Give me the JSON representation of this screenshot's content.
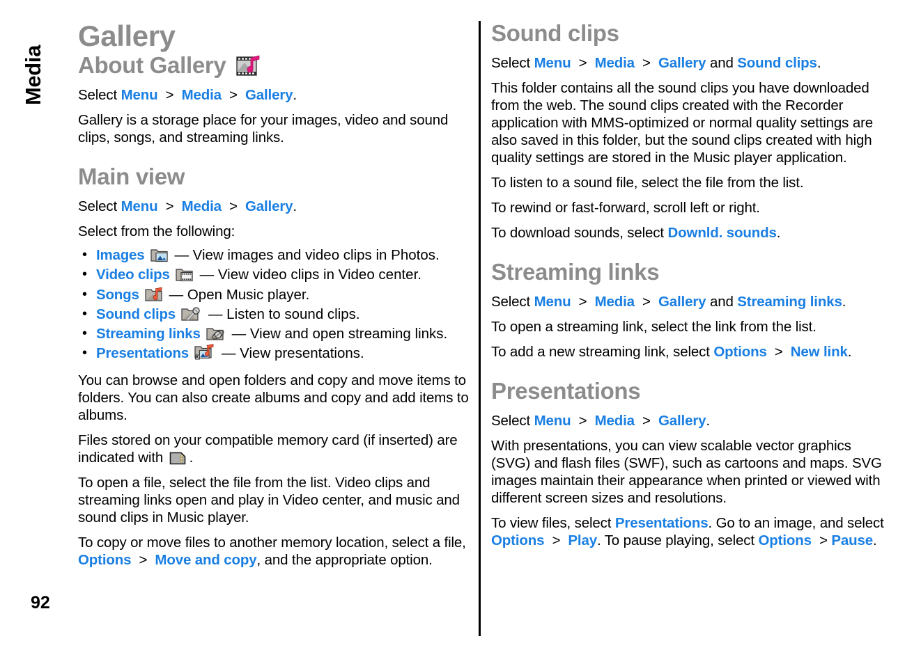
{
  "page": {
    "number": "92",
    "chapter_tab": "Media"
  },
  "left_column": {
    "title": "Gallery",
    "about": {
      "heading": "About Gallery",
      "heading_icon": "film-music-icon",
      "select_prefix": "Select ",
      "path": [
        "Menu",
        "Media",
        "Gallery"
      ],
      "select_suffix": ".",
      "body": "Gallery is a storage place for your images, video and sound clips, songs, and streaming links."
    },
    "main_view": {
      "heading": "Main view",
      "select_prefix": "Select ",
      "path": [
        "Menu",
        "Media",
        "Gallery"
      ],
      "select_suffix": ".",
      "intro": "Select from the following:",
      "items": [
        {
          "label": "Images",
          "icon": "folder-images-icon",
          "desc": "— View images and video clips in Photos."
        },
        {
          "label": "Video clips",
          "icon": "folder-video-icon",
          "desc": "— View video clips in Video center."
        },
        {
          "label": "Songs",
          "icon": "folder-music-icon",
          "desc": "— Open Music player."
        },
        {
          "label": "Sound clips",
          "icon": "folder-microphone-icon",
          "desc": "— Listen to sound clips."
        },
        {
          "label": "Streaming links",
          "icon": "folder-streaming-icon",
          "desc": "— View and open streaming links."
        },
        {
          "label": "Presentations",
          "icon": "folder-presentation-icon",
          "desc": "— View presentations."
        }
      ],
      "para_browse": "You can browse and open folders and copy and move items to folders. You can also create albums and copy and add items to albums.",
      "para_memcard_before": "Files stored on your compatible memory card (if inserted) are indicated with ",
      "memcard_icon": "memory-card-icon",
      "para_memcard_after": ".",
      "para_open": "To open a file, select the file from the list. Video clips and streaming links open and play in Video center, and music and sound clips in Music player.",
      "para_copy_1": "To copy or move files to another memory location, select a file, ",
      "para_copy_options": "Options",
      "para_copy_gt": ">",
      "para_copy_move": "Move and copy",
      "para_copy_2": ", and the appropriate option."
    }
  },
  "right_column": {
    "sound_clips": {
      "heading": "Sound clips",
      "select_prefix": "Select ",
      "path": [
        "Menu",
        "Media",
        "Gallery"
      ],
      "select_and": " and ",
      "select_last": "Sound clips",
      "select_suffix": ".",
      "body": "This folder contains all the sound clips you have downloaded from the web. The sound clips created with the Recorder application with MMS-optimized or normal quality settings are also saved in this folder, but the sound clips created with high quality settings are stored in the Music player application.",
      "para_listen": "To listen to a sound file, select the file from the list.",
      "para_rewind": "To rewind or fast-forward, scroll left or right.",
      "para_download_before": "To download sounds, select ",
      "para_download_link": "Downld. sounds",
      "para_download_after": "."
    },
    "streaming_links": {
      "heading": "Streaming links",
      "select_prefix": "Select ",
      "path": [
        "Menu",
        "Media",
        "Gallery"
      ],
      "select_and": " and ",
      "select_last": "Streaming links",
      "select_suffix": ".",
      "para_open": "To open a streaming link, select the link from the list.",
      "para_add_before": "To add a new streaming link, select ",
      "para_add_options": "Options",
      "para_add_gt": ">",
      "para_add_new": "New link",
      "para_add_after": "."
    },
    "presentations": {
      "heading": "Presentations",
      "select_prefix": "Select ",
      "path": [
        "Menu",
        "Media",
        "Gallery"
      ],
      "select_suffix": ".",
      "body": "With presentations, you can view scalable vector graphics (SVG) and flash files (SWF), such as cartoons and maps. SVG images maintain their appearance when printed or viewed with different screen sizes and resolutions.",
      "para_view_1": "To view files, select ",
      "para_view_presentations": "Presentations",
      "para_view_2": ". Go to an image, and select ",
      "para_view_options1": "Options",
      "para_view_gt1": ">",
      "para_view_play": "Play",
      "para_view_3": ". To pause playing, select ",
      "para_view_options2": "Options",
      "para_view_gt2": ">",
      "para_view_pause": "Pause",
      "para_view_4": "."
    }
  },
  "colors": {
    "link_blue": "#1a7fe3",
    "heading_gray": "#8c8c8c",
    "text_black": "#000000",
    "accent_magenta": "#e3187e"
  }
}
